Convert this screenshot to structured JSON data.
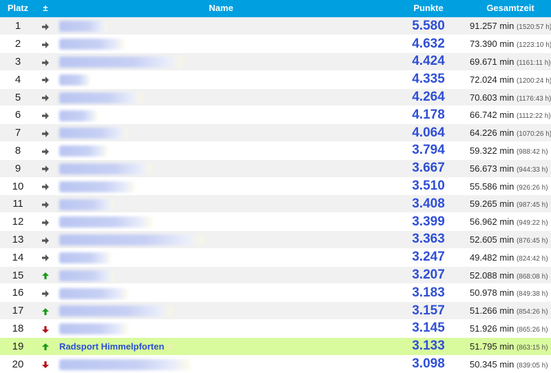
{
  "header": {
    "platz": "Platz",
    "change": "±",
    "name": "Name",
    "punkte": "Punkte",
    "gesamtzeit": "Gesamtzeit"
  },
  "colors": {
    "header_bg": "#009fdf",
    "highlight_bg": "#d9fb9e",
    "points": "#2f4fd6",
    "arrow_up": "#1a9a1a",
    "arrow_down": "#b3121b",
    "arrow_same": "#555555"
  },
  "rows": [
    {
      "platz": "1",
      "trend": "same",
      "name": "",
      "punkte": "5.580",
      "minutes": "91.257 min",
      "hours": "(1520:57 h)"
    },
    {
      "platz": "2",
      "trend": "same",
      "name": "",
      "punkte": "4.632",
      "minutes": "73.390 min",
      "hours": "(1223:10 h)"
    },
    {
      "platz": "3",
      "trend": "same",
      "name": "",
      "punkte": "4.424",
      "minutes": "69.671 min",
      "hours": "(1161:11 h)"
    },
    {
      "platz": "4",
      "trend": "same",
      "name": "",
      "punkte": "4.335",
      "minutes": "72.024 min",
      "hours": "(1200:24 h)"
    },
    {
      "platz": "5",
      "trend": "same",
      "name": "",
      "punkte": "4.264",
      "minutes": "70.603 min",
      "hours": "(1176:43 h)"
    },
    {
      "platz": "6",
      "trend": "same",
      "name": "",
      "punkte": "4.178",
      "minutes": "66.742 min",
      "hours": "(1112:22 h)"
    },
    {
      "platz": "7",
      "trend": "same",
      "name": "",
      "punkte": "4.064",
      "minutes": "64.226 min",
      "hours": "(1070:26 h)"
    },
    {
      "platz": "8",
      "trend": "same",
      "name": "",
      "punkte": "3.794",
      "minutes": "59.322 min",
      "hours": "(988:42 h)"
    },
    {
      "platz": "9",
      "trend": "same",
      "name": "",
      "punkte": "3.667",
      "minutes": "56.673 min",
      "hours": "(944:33 h)"
    },
    {
      "platz": "10",
      "trend": "same",
      "name": "",
      "punkte": "3.510",
      "minutes": "55.586 min",
      "hours": "(926:26 h)"
    },
    {
      "platz": "11",
      "trend": "same",
      "name": "",
      "punkte": "3.408",
      "minutes": "59.265 min",
      "hours": "(987:45 h)"
    },
    {
      "platz": "12",
      "trend": "same",
      "name": "",
      "punkte": "3.399",
      "minutes": "56.962 min",
      "hours": "(949:22 h)"
    },
    {
      "platz": "13",
      "trend": "same",
      "name": "",
      "punkte": "3.363",
      "minutes": "52.605 min",
      "hours": "(876:45 h)"
    },
    {
      "platz": "14",
      "trend": "same",
      "name": "",
      "punkte": "3.247",
      "minutes": "49.482 min",
      "hours": "(824:42 h)"
    },
    {
      "platz": "15",
      "trend": "up",
      "name": "",
      "punkte": "3.207",
      "minutes": "52.088 min",
      "hours": "(868:08 h)"
    },
    {
      "platz": "16",
      "trend": "same",
      "name": "",
      "punkte": "3.183",
      "minutes": "50.978 min",
      "hours": "(849:38 h)"
    },
    {
      "platz": "17",
      "trend": "up",
      "name": "",
      "punkte": "3.157",
      "minutes": "51.266 min",
      "hours": "(854:26 h)"
    },
    {
      "platz": "18",
      "trend": "down",
      "name": "",
      "punkte": "3.145",
      "minutes": "51.926 min",
      "hours": "(865:26 h)"
    },
    {
      "platz": "19",
      "trend": "up",
      "name": "Radsport Himmelpforten",
      "punkte": "3.133",
      "minutes": "51.795 min",
      "hours": "(863:15 h)",
      "highlight": true
    },
    {
      "platz": "20",
      "trend": "down",
      "name": "",
      "punkte": "3.098",
      "minutes": "50.345 min",
      "hours": "(839:05 h)"
    }
  ]
}
